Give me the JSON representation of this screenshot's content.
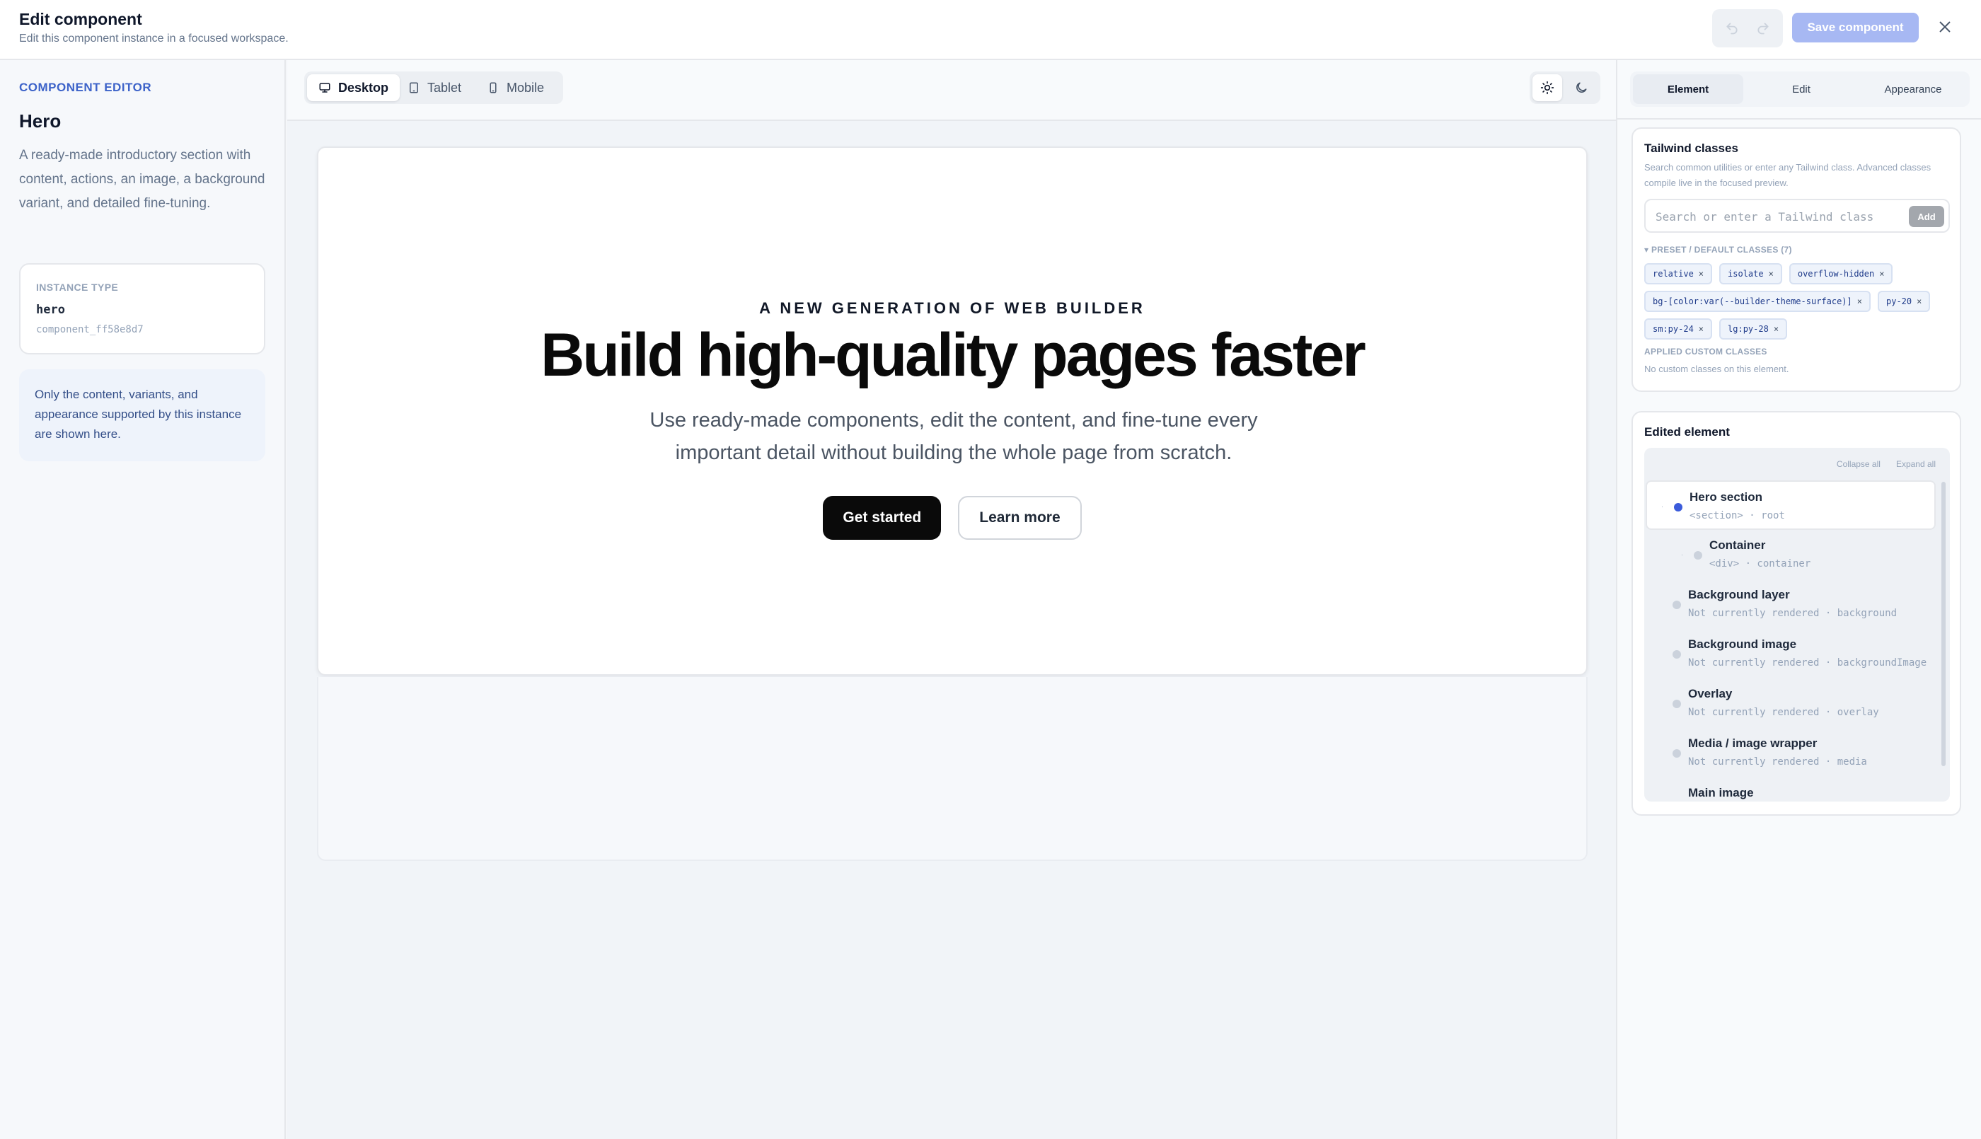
{
  "header": {
    "title": "Edit component",
    "subtitle": "Edit this component instance in a focused workspace.",
    "save_label": "Save component",
    "undo_icon": "undo-icon",
    "redo_icon": "redo-icon",
    "close_icon": "close-icon"
  },
  "sidebar": {
    "eyebrow": "COMPONENT EDITOR",
    "name": "Hero",
    "description": "A ready-made introductory section with content, actions, an image, a background variant, and detailed fine-tuning.",
    "instance_type_label": "INSTANCE TYPE",
    "instance_type_value": "hero",
    "instance_id": "component_ff58e8d7",
    "note": "Only the content, variants, and appearance supported by this instance are shown here."
  },
  "toolbar": {
    "devices": [
      {
        "label": "Desktop",
        "icon": "monitor-icon",
        "active": true
      },
      {
        "label": "Tablet",
        "icon": "tablet-icon",
        "active": false
      },
      {
        "label": "Mobile",
        "icon": "phone-icon",
        "active": false
      }
    ],
    "theme": {
      "light_icon": "sun-icon",
      "dark_icon": "moon-icon",
      "active": "light"
    }
  },
  "preview": {
    "eyebrow": "A NEW GENERATION OF WEB BUILDER",
    "title": "Build high-quality pages faster",
    "lead": "Use ready-made components, edit the content, and fine-tune every important detail without building the whole page from scratch.",
    "primary_action": "Get started",
    "secondary_action": "Learn more"
  },
  "inspector": {
    "tabs": [
      {
        "label": "Element",
        "active": true
      },
      {
        "label": "Edit",
        "active": false
      },
      {
        "label": "Appearance",
        "active": false
      }
    ],
    "tailwind": {
      "heading": "Tailwind classes",
      "help": "Search common utilities or enter any Tailwind class. Advanced classes compile live in the focused preview.",
      "placeholder": "Search or enter a Tailwind class",
      "add_label": "Add",
      "preset_label": "▾ PRESET / DEFAULT CLASSES (7)",
      "preset_classes": [
        "relative",
        "isolate",
        "overflow-hidden",
        "bg-[color:var(--builder-theme-surface)]",
        "py-20",
        "sm:py-24",
        "lg:py-28"
      ],
      "applied_label": "APPLIED CUSTOM CLASSES",
      "applied_empty": "No custom classes on this element."
    },
    "edited": {
      "heading": "Edited element",
      "collapse_all": "Collapse all",
      "expand_all": "Expand all",
      "nodes": [
        {
          "name": "Hero section",
          "sub": "<section> · root",
          "selected": true,
          "caret": "·"
        },
        {
          "name": "Container",
          "sub": "<div> · container",
          "selected": false,
          "caret": "·"
        },
        {
          "name": "Background layer",
          "sub": "Not currently rendered · background",
          "selected": false
        },
        {
          "name": "Background image",
          "sub": "Not currently rendered · backgroundImage",
          "selected": false
        },
        {
          "name": "Overlay",
          "sub": "Not currently rendered · overlay",
          "selected": false
        },
        {
          "name": "Media / image wrapper",
          "sub": "Not currently rendered · media",
          "selected": false
        },
        {
          "name": "Main image",
          "sub": "",
          "selected": false
        }
      ]
    }
  },
  "colors": {
    "accent": "#3d63c9",
    "save_disabled": "#a7b8f3",
    "selected_dot": "#3b5bdb",
    "primary_button": "#0a0a0a"
  }
}
